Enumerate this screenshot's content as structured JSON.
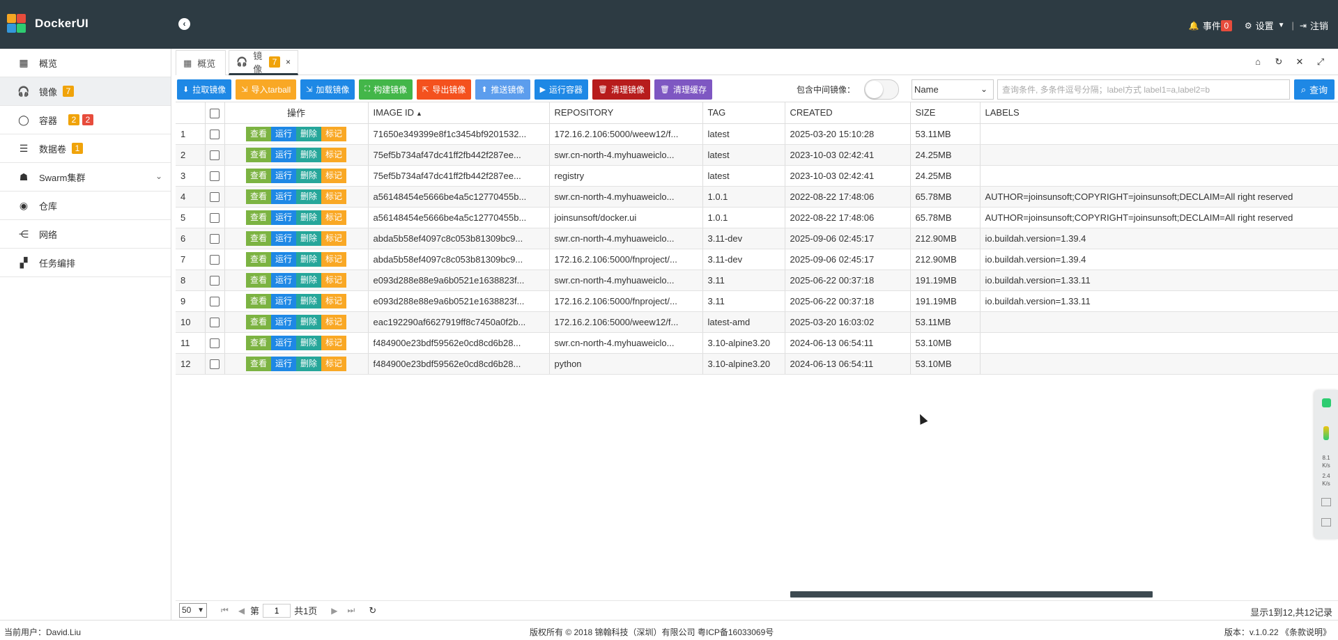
{
  "app": {
    "title": "DockerUI"
  },
  "header": {
    "events_label": "事件",
    "events_count": "0",
    "settings_label": "设置",
    "logout_label": "注销"
  },
  "sidebar": {
    "items": [
      {
        "label": "概览",
        "icon": "windows-icon"
      },
      {
        "label": "镜像",
        "icon": "headphones-icon",
        "badge": "7"
      },
      {
        "label": "容器",
        "icon": "circle-icon",
        "badge1": "2",
        "badge2": "2"
      },
      {
        "label": "数据卷",
        "icon": "database-icon",
        "badge": "1"
      },
      {
        "label": "Swarm集群",
        "icon": "swarm-icon"
      },
      {
        "label": "仓库",
        "icon": "warehouse-icon"
      },
      {
        "label": "网络",
        "icon": "network-icon"
      },
      {
        "label": "任务编排",
        "icon": "tasks-icon"
      }
    ]
  },
  "tabs": [
    {
      "label": "概览"
    },
    {
      "label": "镜像",
      "badge": "7"
    }
  ],
  "toolbar": {
    "buttons": [
      {
        "label": "拉取镜像"
      },
      {
        "label": "导入tarball"
      },
      {
        "label": "加载镜像"
      },
      {
        "label": "构建镜像"
      },
      {
        "label": "导出镜像"
      },
      {
        "label": "推送镜像"
      },
      {
        "label": "运行容器"
      },
      {
        "label": "清理镜像"
      },
      {
        "label": "清理缓存"
      }
    ],
    "include_intermediate_label": "包含中间镜像：",
    "filter_field": "Name",
    "search_placeholder": "查询条件, 多条件逗号分隔；label方式 label1=a,label2=b",
    "search_label": "查询"
  },
  "table": {
    "columns": [
      "操作",
      "IMAGE ID",
      "REPOSITORY",
      "TAG",
      "CREATED",
      "SIZE",
      "LABELS"
    ],
    "op_labels": {
      "view": "查看",
      "run": "运行",
      "delete": "删除",
      "tag": "标记"
    },
    "rows": [
      {
        "n": "1",
        "id": "71650e349399e8f1c3454bf9201532...",
        "repo": "172.16.2.106:5000/weew12/f...",
        "tag": "latest",
        "created": "2025-03-20 15:10:28",
        "size": "53.11MB",
        "labels": ""
      },
      {
        "n": "2",
        "id": "75ef5b734af47dc41ff2fb442f287ee...",
        "repo": "swr.cn-north-4.myhuaweiclo...",
        "tag": "latest",
        "created": "2023-10-03 02:42:41",
        "size": "24.25MB",
        "labels": ""
      },
      {
        "n": "3",
        "id": "75ef5b734af47dc41ff2fb442f287ee...",
        "repo": "registry",
        "tag": "latest",
        "created": "2023-10-03 02:42:41",
        "size": "24.25MB",
        "labels": ""
      },
      {
        "n": "4",
        "id": "a56148454e5666be4a5c12770455b...",
        "repo": "swr.cn-north-4.myhuaweiclo...",
        "tag": "1.0.1",
        "created": "2022-08-22 17:48:06",
        "size": "65.78MB",
        "labels": "AUTHOR=joinsunsoft;COPYRIGHT=joinsunsoft;DECLAIM=All right reserved"
      },
      {
        "n": "5",
        "id": "a56148454e5666be4a5c12770455b...",
        "repo": "joinsunsoft/docker.ui",
        "tag": "1.0.1",
        "created": "2022-08-22 17:48:06",
        "size": "65.78MB",
        "labels": "AUTHOR=joinsunsoft;COPYRIGHT=joinsunsoft;DECLAIM=All right reserved"
      },
      {
        "n": "6",
        "id": "abda5b58ef4097c8c053b81309bc9...",
        "repo": "swr.cn-north-4.myhuaweiclo...",
        "tag": "3.11-dev",
        "created": "2025-09-06 02:45:17",
        "size": "212.90MB",
        "labels": "io.buildah.version=1.39.4"
      },
      {
        "n": "7",
        "id": "abda5b58ef4097c8c053b81309bc9...",
        "repo": "172.16.2.106:5000/fnproject/...",
        "tag": "3.11-dev",
        "created": "2025-09-06 02:45:17",
        "size": "212.90MB",
        "labels": "io.buildah.version=1.39.4"
      },
      {
        "n": "8",
        "id": "e093d288e88e9a6b0521e1638823f...",
        "repo": "swr.cn-north-4.myhuaweiclo...",
        "tag": "3.11",
        "created": "2025-06-22 00:37:18",
        "size": "191.19MB",
        "labels": "io.buildah.version=1.33.11"
      },
      {
        "n": "9",
        "id": "e093d288e88e9a6b0521e1638823f...",
        "repo": "172.16.2.106:5000/fnproject/...",
        "tag": "3.11",
        "created": "2025-06-22 00:37:18",
        "size": "191.19MB",
        "labels": "io.buildah.version=1.33.11"
      },
      {
        "n": "10",
        "id": "eac192290af6627919ff8c7450a0f2b...",
        "repo": "172.16.2.106:5000/weew12/f...",
        "tag": "latest-amd",
        "created": "2025-03-20 16:03:02",
        "size": "53.11MB",
        "labels": ""
      },
      {
        "n": "11",
        "id": "f484900e23bdf59562e0cd8cd6b28...",
        "repo": "swr.cn-north-4.myhuaweiclo...",
        "tag": "3.10-alpine3.20",
        "created": "2024-06-13 06:54:11",
        "size": "53.10MB",
        "labels": ""
      },
      {
        "n": "12",
        "id": "f484900e23bdf59562e0cd8cd6b28...",
        "repo": "python",
        "tag": "3.10-alpine3.20",
        "created": "2024-06-13 06:54:11",
        "size": "53.10MB",
        "labels": ""
      }
    ]
  },
  "pager": {
    "page_size": "50",
    "page_prefix": "第",
    "page_value": "1",
    "page_total": "共1页",
    "info": "显示1到12,共12记录"
  },
  "footer": {
    "user": "当前用户：David.Liu",
    "copyright": "版权所有 © 2018 锦翰科技（深圳）有限公司 粤ICP备16033069号",
    "version": "版本：v.1.0.22 《条款说明》"
  },
  "widget": {
    "up": "8.1",
    "up_unit": "K/s",
    "down": "2.4",
    "down_unit": "K/s"
  },
  "colors": {
    "header_bg": "#2d3b43",
    "primary": "#1e88e5",
    "badge_orange": "#f0a30a",
    "badge_red": "#e74c3c"
  }
}
